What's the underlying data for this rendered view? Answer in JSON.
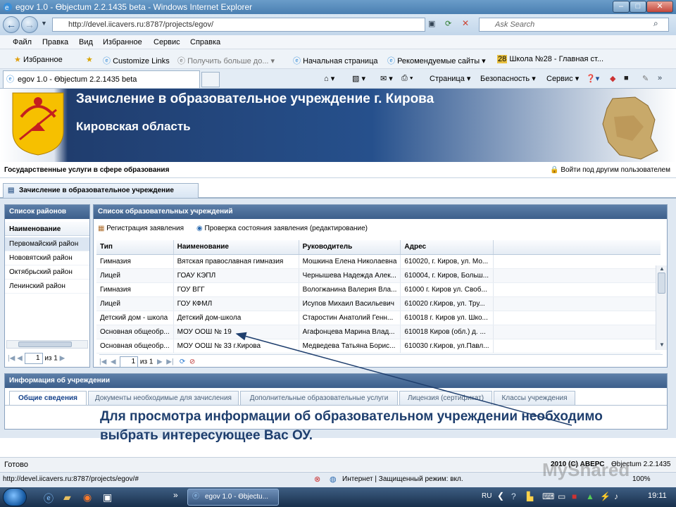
{
  "window": {
    "title": "egov 1.0 - Өbjectum 2.2.1435 beta - Windows Internet Explorer"
  },
  "browser": {
    "url": "http://devel.iicavers.ru:8787/projects/egov/",
    "search_placeholder": "Ask Search",
    "menu": [
      "Файл",
      "Правка",
      "Вид",
      "Избранное",
      "Сервис",
      "Справка"
    ],
    "favorites_label": "Избранное",
    "fav_links": [
      "Customize Links",
      "Получить больше до...",
      "Начальная страница",
      "Рекомендуемые сайты",
      "Школа №28 - Главная ст..."
    ],
    "tab_title": "egov 1.0 - Өbjectum 2.2.1435 beta",
    "commands": [
      "Страница",
      "Безопасность",
      "Сервис"
    ]
  },
  "banner": {
    "title": "Зачисление в образовательное учреждение г. Кирова",
    "subtitle": "Кировская область"
  },
  "services": {
    "title": "Государственные услуги в сфере образования",
    "login_link": "Войти под другим пользователем"
  },
  "page_tab": "Зачисление в образовательное учреждение",
  "districts": {
    "panel_title": "Список районов",
    "column": "Наименование",
    "items": [
      "Первомайский район",
      "Нововятский район",
      "Октябрьский район",
      "Ленинский район"
    ],
    "pager": {
      "page": "1",
      "of": "из 1"
    }
  },
  "schools": {
    "panel_title": "Список образовательных учреждений",
    "toolbar": [
      "Регистрация заявления",
      "Проверка состояния заявления (редактирование)"
    ],
    "columns": [
      "Тип",
      "Наименование",
      "Руководитель",
      "Адрес"
    ],
    "rows": [
      [
        "Гимназия",
        "Вятская православная гимназия",
        "Мошкина Елена Николаевна",
        "610020, г. Киров, ул. Мо..."
      ],
      [
        "Лицей",
        "ГОАУ КЭПЛ",
        "Чернышева Надежда Алек...",
        "610004, г. Киров, Больш..."
      ],
      [
        "Гимназия",
        "ГОУ ВГГ",
        "Вологжанина Валерия Вла...",
        "61000 г. Киров ул. Своб..."
      ],
      [
        "Лицей",
        "ГОУ КФМЛ",
        "Исупов Михаил Васильевич",
        "610020 г.Киров, ул. Тру..."
      ],
      [
        "Детский дом - школа",
        "Детский дом-школа",
        "Старостин Анатолий Генн...",
        "610018 г. Киров ул. Шко..."
      ],
      [
        "Основная общеобр...",
        "МОУ ООШ № 19",
        "Агафонцева Марина Влад...",
        "610018 Киров (обл.) д. ..."
      ],
      [
        "Основная общеобр...",
        "МОУ ООШ № 33 г.Кирова",
        "Медведева Татьяна Борис...",
        "610030 г.Киров, ул.Павл..."
      ]
    ],
    "pager": {
      "page": "1",
      "of": "из 1"
    }
  },
  "info": {
    "panel_title": "Информация об учреждении",
    "tabs": [
      "Общие сведения",
      "Документы необходимые для зачисления",
      "Дополнительные образовательные услуги",
      "Лицензия (сертификат)",
      "Классы учреждения"
    ]
  },
  "note": "Для просмотра информации об образовательном учреждении необходимо выбрать интересующее Вас ОУ.",
  "status": {
    "left": "Готово",
    "copyright": "2010 (С) АВЕРС",
    "version": "Өbjectum 2.2.1435"
  },
  "ie_status": {
    "url": "http://devel.iicavers.ru:8787/projects/egov/#",
    "zone": "Интернет | Защищенный режим: вкл.",
    "zoom": "100%"
  },
  "taskbar": {
    "task": "egov 1.0 - Өbjectu...",
    "lang": "RU",
    "time": "19:11"
  },
  "watermark": "MyShared",
  "colors": {
    "panel_header": "#4a6d99",
    "note_text": "#1f3f6e",
    "arrow": "#1f3f6e"
  }
}
